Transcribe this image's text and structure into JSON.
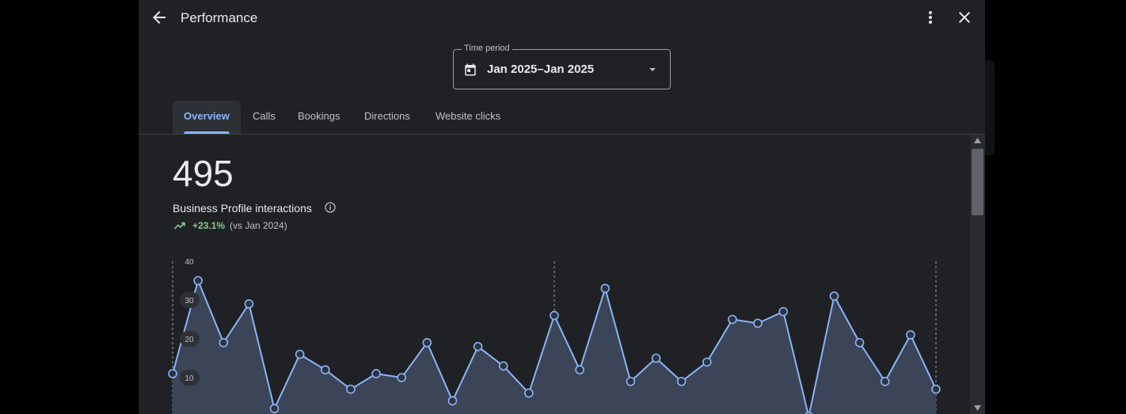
{
  "dialog": {
    "title": "Performance"
  },
  "icons": {
    "back": "arrow-left-icon",
    "more": "more-vert-icon",
    "close": "close-icon",
    "calendar": "calendar-icon",
    "dropdown": "caret-down-icon",
    "info": "info-icon",
    "trend": "trending-up-icon"
  },
  "time_period": {
    "label": "Time period",
    "value": "Jan 2025–Jan 2025"
  },
  "tabs": [
    {
      "label": "Overview",
      "active": true
    },
    {
      "label": "Calls",
      "active": false
    },
    {
      "label": "Bookings",
      "active": false
    },
    {
      "label": "Directions",
      "active": false
    },
    {
      "label": "Website clicks",
      "active": false
    }
  ],
  "metric": {
    "value": "495",
    "label": "Business Profile interactions",
    "change": "+23.1%",
    "comparison": "(vs Jan 2024)"
  },
  "colors": {
    "background": "#202124",
    "accent": "#8ab4f8",
    "positive": "#81c995",
    "area_fill": "#3b4557"
  },
  "chart_data": {
    "type": "area",
    "y_ticks": [
      "10",
      "20",
      "30",
      "40"
    ],
    "ylim": [
      0,
      40
    ],
    "x": [
      1,
      2,
      3,
      4,
      5,
      6,
      7,
      8,
      9,
      10,
      11,
      12,
      13,
      14,
      15,
      16,
      17,
      18,
      19,
      20,
      21,
      22,
      23,
      24,
      25,
      26,
      27,
      28,
      29,
      30,
      31
    ],
    "values": [
      11,
      35,
      19,
      29,
      2,
      16,
      12,
      7,
      11,
      10,
      19,
      4,
      18,
      13,
      6,
      26,
      12,
      33,
      9,
      15,
      9,
      14,
      25,
      24,
      27,
      0,
      31,
      19,
      9,
      21,
      7
    ]
  }
}
